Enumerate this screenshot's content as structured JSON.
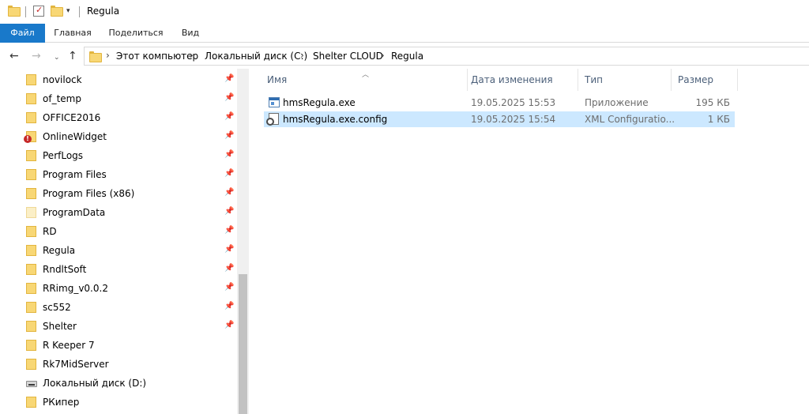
{
  "window": {
    "title": "Regula"
  },
  "ribbon": {
    "tabs": [
      {
        "label": "Файл",
        "active": true
      },
      {
        "label": "Главная"
      },
      {
        "label": "Поделиться"
      },
      {
        "label": "Вид"
      }
    ]
  },
  "address": {
    "crumbs": [
      "Этот компьютер",
      "Локальный диск (C:)",
      "Shelter CLOUD",
      "Regula"
    ]
  },
  "nav": {
    "items": [
      {
        "label": "novilock",
        "icon": "folder-icon",
        "pinned": true
      },
      {
        "label": "of_temp",
        "icon": "folder-icon",
        "pinned": true
      },
      {
        "label": "OFFICE2016",
        "icon": "folder-icon",
        "pinned": true
      },
      {
        "label": "OnlineWidget",
        "icon": "folder-warning-icon",
        "pinned": true
      },
      {
        "label": "PerfLogs",
        "icon": "folder-icon",
        "pinned": true
      },
      {
        "label": "Program Files",
        "icon": "folder-icon",
        "pinned": true
      },
      {
        "label": "Program Files (x86)",
        "icon": "folder-icon",
        "pinned": true
      },
      {
        "label": "ProgramData",
        "icon": "folder-light-icon",
        "pinned": true
      },
      {
        "label": "RD",
        "icon": "folder-icon",
        "pinned": true
      },
      {
        "label": "Regula",
        "icon": "folder-icon",
        "pinned": true
      },
      {
        "label": "RndltSoft",
        "icon": "folder-icon",
        "pinned": true
      },
      {
        "label": "RRimg_v0.0.2",
        "icon": "folder-icon",
        "pinned": true
      },
      {
        "label": "sc552",
        "icon": "folder-icon",
        "pinned": true
      },
      {
        "label": "Shelter",
        "icon": "folder-icon",
        "pinned": true
      },
      {
        "label": "R Keeper 7",
        "icon": "folder-icon",
        "pinned": false
      },
      {
        "label": "Rk7MidServer",
        "icon": "folder-icon",
        "pinned": false
      },
      {
        "label": "Локальный диск (D:)",
        "icon": "drive-icon",
        "pinned": false
      },
      {
        "label": "РКипер",
        "icon": "folder-icon",
        "pinned": false
      }
    ]
  },
  "filelist": {
    "columns": [
      "Имя",
      "Дата изменения",
      "Тип",
      "Размер"
    ],
    "rows": [
      {
        "name": "hmsRegula.exe",
        "date": "19.05.2025 15:53",
        "type": "Приложение",
        "size": "195 КБ",
        "icon": "exe-icon",
        "selected": false
      },
      {
        "name": "hmsRegula.exe.config",
        "date": "19.05.2025 15:54",
        "type": "XML Configuratio...",
        "size": "1 КБ",
        "icon": "config-file-icon",
        "selected": true
      }
    ]
  },
  "colors": {
    "file_tab": "#1979ca",
    "selection": "#cce8ff",
    "folder": "#f8d775"
  }
}
